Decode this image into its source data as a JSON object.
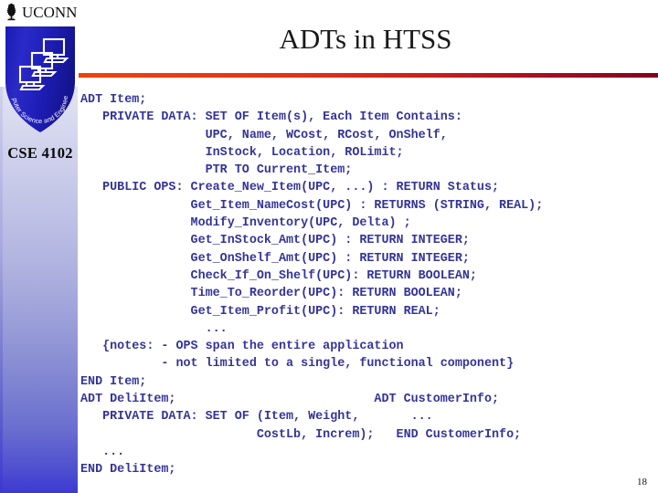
{
  "branding": {
    "university_wordmark": "UCONN",
    "university_emblem_icon": "oak-leaf-emblem-icon",
    "shield_icon": "cse-shield-icon",
    "shield_motto": "Computer Science and Engineering",
    "course_label": "CSE 4102"
  },
  "header": {
    "title": "ADTs in HTSS",
    "rule_color_start": "#F3410D",
    "rule_color_end": "#820220"
  },
  "theme": {
    "code_color": "#343499",
    "band_top_color": "#E2E3F2",
    "band_bottom_color": "#3D39D2",
    "title_color": "#1A1A1A",
    "background": "#FFFFFF"
  },
  "code": {
    "language_label": "ADT specification pseudocode",
    "lines": [
      "ADT Item;",
      "   PRIVATE DATA: SET OF Item(s), Each Item Contains:",
      "                 UPC, Name, WCost, RCost, OnShelf,",
      "                 InStock, Location, ROLimit;",
      "                 PTR TO Current_Item;",
      "   PUBLIC OPS: Create_New_Item(UPC, ...) : RETURN Status;",
      "               Get_Item_NameCost(UPC) : RETURNS (STRING, REAL);",
      "               Modify_Inventory(UPC, Delta) ;",
      "               Get_InStock_Amt(UPC) : RETURN INTEGER;",
      "               Get_OnShelf_Amt(UPC) : RETURN INTEGER;",
      "               Check_If_On_Shelf(UPC): RETURN BOOLEAN;",
      "               Time_To_Reorder(UPC): RETURN BOOLEAN;",
      "               Get_Item_Profit(UPC): RETURN REAL;",
      "                 ...",
      "   {notes: - OPS span the entire application",
      "           - not limited to a single, functional component}",
      "END Item;",
      "ADT DeliItem;                           ADT CustomerInfo;",
      "   PRIVATE DATA: SET OF (Item, Weight,       ...",
      "                        CostLb, Increm);   END CustomerInfo;",
      "   ...",
      "END DeliItem;"
    ]
  },
  "footer": {
    "page_number": "18"
  }
}
